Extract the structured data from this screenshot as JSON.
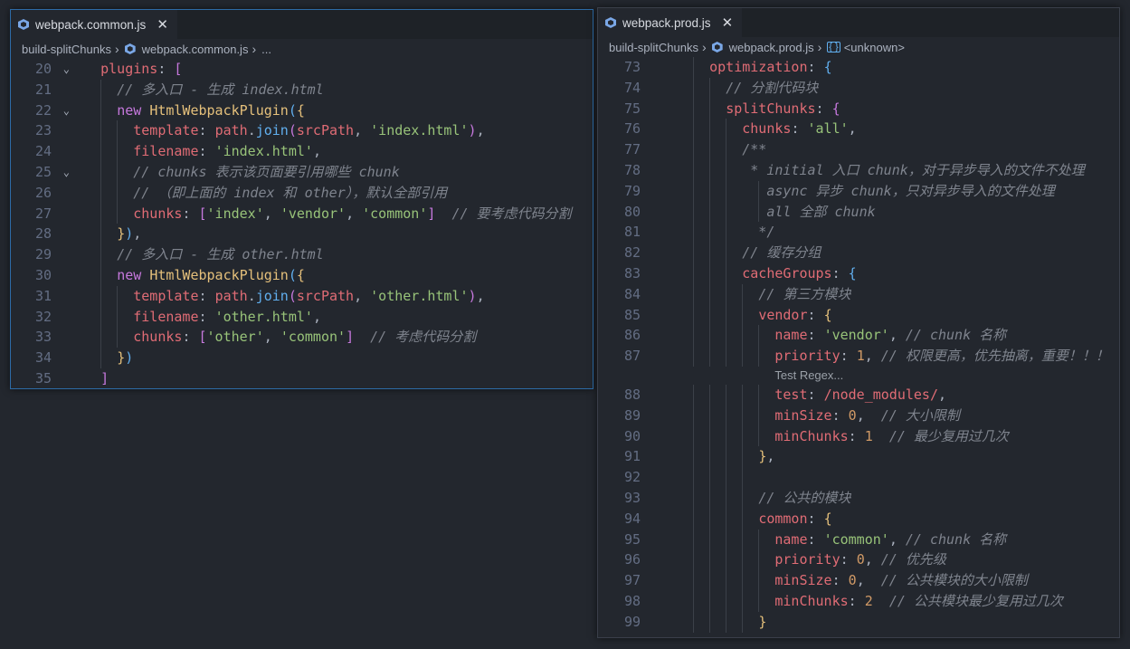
{
  "left": {
    "tab": "webpack.common.js",
    "crumbs": [
      "build-splitChunks",
      "webpack.common.js",
      "..."
    ],
    "lines": [
      {
        "no": "20",
        "fold": true,
        "guides": [],
        "indent": 4,
        "t": [
          [
            "p",
            "plugins"
          ],
          [
            "d",
            ": "
          ],
          [
            "b1",
            "["
          ]
        ]
      },
      {
        "no": "21",
        "guides": [
          4
        ],
        "indent": 6,
        "t": [
          [
            "c",
            "// 多入口 - 生成 index.html"
          ]
        ]
      },
      {
        "no": "22",
        "fold": true,
        "guides": [
          4
        ],
        "indent": 6,
        "t": [
          [
            "k",
            "new "
          ],
          [
            "cls",
            "HtmlWebpackPlugin"
          ],
          [
            "b2",
            "("
          ],
          [
            "b3",
            "{"
          ]
        ]
      },
      {
        "no": "23",
        "guides": [
          4,
          6
        ],
        "indent": 8,
        "t": [
          [
            "p",
            "template"
          ],
          [
            "d",
            ": "
          ],
          [
            "p",
            "path"
          ],
          [
            "d",
            "."
          ],
          [
            "f",
            "join"
          ],
          [
            "b1",
            "("
          ],
          [
            "p",
            "srcPath"
          ],
          [
            "d",
            ", "
          ],
          [
            "s",
            "'index.html'"
          ],
          [
            "b1",
            ")"
          ],
          [
            "d",
            ","
          ]
        ]
      },
      {
        "no": "24",
        "guides": [
          4,
          6
        ],
        "indent": 8,
        "t": [
          [
            "p",
            "filename"
          ],
          [
            "d",
            ": "
          ],
          [
            "s",
            "'index.html'"
          ],
          [
            "d",
            ","
          ]
        ]
      },
      {
        "no": "25",
        "fold": true,
        "guides": [
          4,
          6
        ],
        "indent": 8,
        "t": [
          [
            "c",
            "// chunks 表示该页面要引用哪些 chunk"
          ]
        ]
      },
      {
        "no": "26",
        "guides": [
          4,
          6
        ],
        "indent": 8,
        "t": [
          [
            "c",
            "// （即上面的 index 和 other），默认全部引用"
          ]
        ]
      },
      {
        "no": "27",
        "guides": [
          4,
          6
        ],
        "indent": 8,
        "t": [
          [
            "p",
            "chunks"
          ],
          [
            "d",
            ": "
          ],
          [
            "b1",
            "["
          ],
          [
            "s",
            "'index'"
          ],
          [
            "d",
            ", "
          ],
          [
            "s",
            "'vendor'"
          ],
          [
            "d",
            ", "
          ],
          [
            "s",
            "'common'"
          ],
          [
            "b1",
            "]"
          ],
          [
            "d",
            "  "
          ],
          [
            "c",
            "// 要考虑代码分割"
          ]
        ]
      },
      {
        "no": "28",
        "guides": [
          4
        ],
        "indent": 6,
        "t": [
          [
            "b3",
            "}"
          ],
          [
            "b2",
            ")"
          ],
          [
            "d",
            ","
          ]
        ]
      },
      {
        "no": "29",
        "guides": [
          4
        ],
        "indent": 6,
        "t": [
          [
            "c",
            "// 多入口 - 生成 other.html"
          ]
        ]
      },
      {
        "no": "30",
        "guides": [
          4
        ],
        "indent": 6,
        "t": [
          [
            "k",
            "new "
          ],
          [
            "cls",
            "HtmlWebpackPlugin"
          ],
          [
            "b2",
            "("
          ],
          [
            "b3",
            "{"
          ]
        ]
      },
      {
        "no": "31",
        "guides": [
          4,
          6
        ],
        "indent": 8,
        "t": [
          [
            "p",
            "template"
          ],
          [
            "d",
            ": "
          ],
          [
            "p",
            "path"
          ],
          [
            "d",
            "."
          ],
          [
            "f",
            "join"
          ],
          [
            "b1",
            "("
          ],
          [
            "p",
            "srcPath"
          ],
          [
            "d",
            ", "
          ],
          [
            "s",
            "'other.html'"
          ],
          [
            "b1",
            ")"
          ],
          [
            "d",
            ","
          ]
        ]
      },
      {
        "no": "32",
        "guides": [
          4,
          6
        ],
        "indent": 8,
        "t": [
          [
            "p",
            "filename"
          ],
          [
            "d",
            ": "
          ],
          [
            "s",
            "'other.html'"
          ],
          [
            "d",
            ","
          ]
        ]
      },
      {
        "no": "33",
        "guides": [
          4,
          6
        ],
        "indent": 8,
        "t": [
          [
            "p",
            "chunks"
          ],
          [
            "d",
            ": "
          ],
          [
            "b1",
            "["
          ],
          [
            "s",
            "'other'"
          ],
          [
            "d",
            ", "
          ],
          [
            "s",
            "'common'"
          ],
          [
            "b1",
            "]"
          ],
          [
            "d",
            "  "
          ],
          [
            "c",
            "// 考虑代码分割"
          ]
        ]
      },
      {
        "no": "34",
        "guides": [
          4
        ],
        "indent": 6,
        "t": [
          [
            "b3",
            "}"
          ],
          [
            "b2",
            ")"
          ]
        ]
      },
      {
        "no": "35",
        "guides": [],
        "indent": 4,
        "t": [
          [
            "b1",
            "]"
          ]
        ]
      }
    ]
  },
  "right": {
    "tab": "webpack.prod.js",
    "crumbs": [
      "build-splitChunks",
      "webpack.prod.js",
      "<unknown>"
    ],
    "hint": "Test Regex...",
    "lines": [
      {
        "no": "73",
        "guides": [
          2
        ],
        "indent": 4,
        "t": [
          [
            "p",
            "optimization"
          ],
          [
            "d",
            ": "
          ],
          [
            "b2",
            "{"
          ]
        ]
      },
      {
        "no": "74",
        "guides": [
          2,
          4
        ],
        "indent": 6,
        "t": [
          [
            "c",
            "// 分割代码块"
          ]
        ]
      },
      {
        "no": "75",
        "guides": [
          2,
          4
        ],
        "indent": 6,
        "t": [
          [
            "p",
            "splitChunks"
          ],
          [
            "d",
            ": "
          ],
          [
            "b1",
            "{"
          ]
        ]
      },
      {
        "no": "76",
        "guides": [
          2,
          4,
          6
        ],
        "indent": 8,
        "t": [
          [
            "p",
            "chunks"
          ],
          [
            "d",
            ": "
          ],
          [
            "s",
            "'all'"
          ],
          [
            "d",
            ","
          ]
        ]
      },
      {
        "no": "77",
        "guides": [
          2,
          4,
          6
        ],
        "indent": 8,
        "t": [
          [
            "c",
            "/**"
          ]
        ]
      },
      {
        "no": "78",
        "guides": [
          2,
          4,
          6
        ],
        "indent": 8,
        "t": [
          [
            "c",
            " * initial 入口 chunk，对于异步导入的文件不处理"
          ]
        ]
      },
      {
        "no": "79",
        "guides": [
          2,
          4,
          6,
          10
        ],
        "indent": 11,
        "t": [
          [
            "c",
            "async 异步 chunk，只对异步导入的文件处理"
          ]
        ]
      },
      {
        "no": "80",
        "guides": [
          2,
          4,
          6,
          10
        ],
        "indent": 11,
        "t": [
          [
            "c",
            "all 全部 chunk"
          ]
        ]
      },
      {
        "no": "81",
        "guides": [
          2,
          4,
          6
        ],
        "indent": 8,
        "t": [
          [
            "c",
            "  */"
          ]
        ]
      },
      {
        "no": "82",
        "guides": [
          2,
          4,
          6
        ],
        "indent": 8,
        "t": [
          [
            "c",
            "// 缓存分组"
          ]
        ]
      },
      {
        "no": "83",
        "guides": [
          2,
          4,
          6
        ],
        "indent": 8,
        "t": [
          [
            "p",
            "cacheGroups"
          ],
          [
            "d",
            ": "
          ],
          [
            "b2",
            "{"
          ]
        ]
      },
      {
        "no": "84",
        "guides": [
          2,
          4,
          6,
          8
        ],
        "indent": 10,
        "t": [
          [
            "c",
            "// 第三方模块"
          ]
        ]
      },
      {
        "no": "85",
        "guides": [
          2,
          4,
          6,
          8
        ],
        "indent": 10,
        "t": [
          [
            "p",
            "vendor"
          ],
          [
            "d",
            ": "
          ],
          [
            "b3",
            "{"
          ]
        ]
      },
      {
        "no": "86",
        "guides": [
          2,
          4,
          6,
          8,
          10
        ],
        "indent": 12,
        "t": [
          [
            "p",
            "name"
          ],
          [
            "d",
            ": "
          ],
          [
            "s",
            "'vendor'"
          ],
          [
            "d",
            ", "
          ],
          [
            "c",
            "// chunk 名称"
          ]
        ]
      },
      {
        "no": "87",
        "guides": [
          2,
          4,
          6,
          8,
          10
        ],
        "indent": 12,
        "t": [
          [
            "p",
            "priority"
          ],
          [
            "d",
            ": "
          ],
          [
            "n",
            "1"
          ],
          [
            "d",
            ", "
          ],
          [
            "c",
            "// 权限更高，优先抽离，重要！！！"
          ]
        ],
        "hintAfter": true
      },
      {
        "no": "88",
        "guides": [
          2,
          4,
          6,
          8,
          10
        ],
        "indent": 12,
        "t": [
          [
            "p",
            "test"
          ],
          [
            "d",
            ": "
          ],
          [
            "r",
            "/node_modules/"
          ],
          [
            "d",
            ","
          ]
        ]
      },
      {
        "no": "89",
        "guides": [
          2,
          4,
          6,
          8,
          10
        ],
        "indent": 12,
        "t": [
          [
            "p",
            "minSize"
          ],
          [
            "d",
            ": "
          ],
          [
            "n",
            "0"
          ],
          [
            "d",
            ",  "
          ],
          [
            "c",
            "// 大小限制"
          ]
        ]
      },
      {
        "no": "90",
        "guides": [
          2,
          4,
          6,
          8,
          10
        ],
        "indent": 12,
        "t": [
          [
            "p",
            "minChunks"
          ],
          [
            "d",
            ": "
          ],
          [
            "n",
            "1"
          ],
          [
            "d",
            "  "
          ],
          [
            "c",
            "// 最少复用过几次"
          ]
        ]
      },
      {
        "no": "91",
        "guides": [
          2,
          4,
          6,
          8
        ],
        "indent": 10,
        "t": [
          [
            "b3",
            "}"
          ],
          [
            "d",
            ","
          ]
        ]
      },
      {
        "no": "92",
        "guides": [
          2,
          4,
          6,
          8
        ],
        "indent": 10,
        "t": []
      },
      {
        "no": "93",
        "guides": [
          2,
          4,
          6,
          8
        ],
        "indent": 10,
        "t": [
          [
            "c",
            "// 公共的模块"
          ]
        ]
      },
      {
        "no": "94",
        "guides": [
          2,
          4,
          6,
          8
        ],
        "indent": 10,
        "t": [
          [
            "p",
            "common"
          ],
          [
            "d",
            ": "
          ],
          [
            "b3",
            "{"
          ]
        ]
      },
      {
        "no": "95",
        "guides": [
          2,
          4,
          6,
          8,
          10
        ],
        "indent": 12,
        "t": [
          [
            "p",
            "name"
          ],
          [
            "d",
            ": "
          ],
          [
            "s",
            "'common'"
          ],
          [
            "d",
            ", "
          ],
          [
            "c",
            "// chunk 名称"
          ]
        ]
      },
      {
        "no": "96",
        "guides": [
          2,
          4,
          6,
          8,
          10
        ],
        "indent": 12,
        "t": [
          [
            "p",
            "priority"
          ],
          [
            "d",
            ": "
          ],
          [
            "n",
            "0"
          ],
          [
            "d",
            ", "
          ],
          [
            "c",
            "// 优先级"
          ]
        ]
      },
      {
        "no": "97",
        "guides": [
          2,
          4,
          6,
          8,
          10
        ],
        "indent": 12,
        "t": [
          [
            "p",
            "minSize"
          ],
          [
            "d",
            ": "
          ],
          [
            "n",
            "0"
          ],
          [
            "d",
            ",  "
          ],
          [
            "c",
            "// 公共模块的大小限制"
          ]
        ]
      },
      {
        "no": "98",
        "guides": [
          2,
          4,
          6,
          8,
          10
        ],
        "indent": 12,
        "t": [
          [
            "p",
            "minChunks"
          ],
          [
            "d",
            ": "
          ],
          [
            "n",
            "2"
          ],
          [
            "d",
            "  "
          ],
          [
            "c",
            "// 公共模块最少复用过几次"
          ]
        ]
      },
      {
        "no": "99",
        "guides": [
          2,
          4,
          6,
          8
        ],
        "indent": 10,
        "t": [
          [
            "b3",
            "}"
          ]
        ]
      }
    ]
  }
}
